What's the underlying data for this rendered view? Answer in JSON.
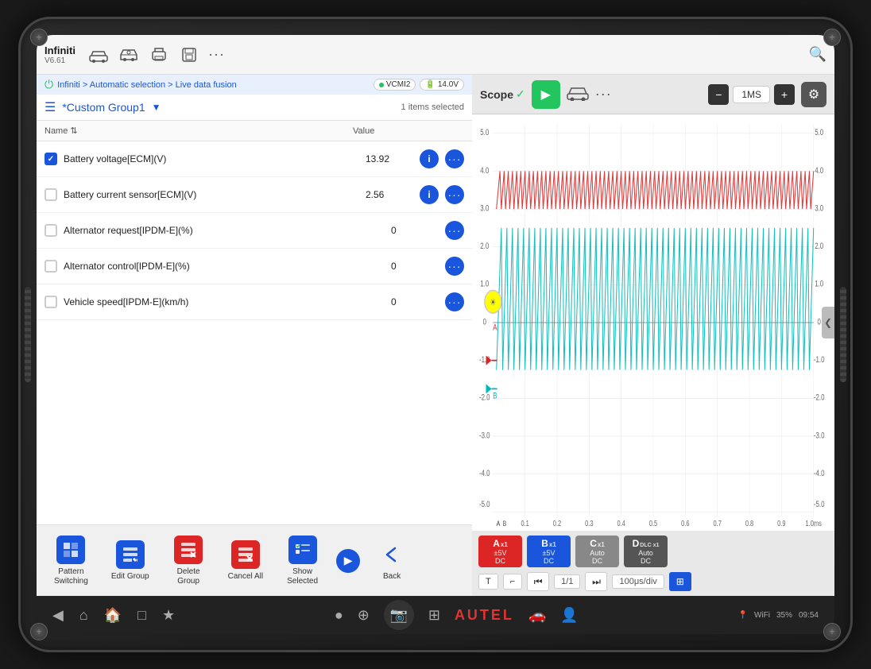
{
  "tablet": {
    "brand": "AUTEL"
  },
  "app_bar": {
    "brand_name": "Infiniti",
    "brand_version": "V6.61",
    "icons": [
      "car-icon",
      "car2-icon",
      "print-icon",
      "save-icon"
    ],
    "dots_label": "···",
    "search_label": "🔍"
  },
  "breadcrumb": {
    "path": "Infiniti > Automatic selection > Live data fusion",
    "vcmi_label": "VCMI2",
    "voltage_label": "14.0V"
  },
  "group": {
    "name": "*Custom Group1",
    "selected_count": "1 items selected"
  },
  "table": {
    "col_name": "Name",
    "col_sort": "⇅",
    "col_value": "Value",
    "rows": [
      {
        "id": "row-1",
        "checked": true,
        "name": "Battery voltage[ECM](V)",
        "value": "13.92",
        "has_info": true,
        "has_more": true
      },
      {
        "id": "row-2",
        "checked": false,
        "name": "Battery current sensor[ECM](V)",
        "value": "2.56",
        "has_info": true,
        "has_more": true
      },
      {
        "id": "row-3",
        "checked": false,
        "name": "Alternator request[IPDM-E](%)",
        "value": "0",
        "has_info": false,
        "has_more": true
      },
      {
        "id": "row-4",
        "checked": false,
        "name": "Alternator control[IPDM-E](%)",
        "value": "0",
        "has_info": false,
        "has_more": true
      },
      {
        "id": "row-5",
        "checked": false,
        "name": "Vehicle speed[IPDM-E](km/h)",
        "value": "0",
        "has_info": false,
        "has_more": true
      }
    ]
  },
  "toolbar": {
    "buttons": [
      {
        "id": "pattern-switching",
        "label": "Pattern\nSwitching",
        "icon": "pattern-icon"
      },
      {
        "id": "edit-group",
        "label": "Edit Group",
        "icon": "edit-icon"
      },
      {
        "id": "delete-group",
        "label": "Delete\nGroup",
        "icon": "delete-icon"
      },
      {
        "id": "cancel-all",
        "label": "Cancel All",
        "icon": "cancel-icon"
      },
      {
        "id": "show-selected",
        "label": "Show\nSelected",
        "icon": "show-icon"
      }
    ],
    "back_label": "Back"
  },
  "scope": {
    "logo": "Scope",
    "time_value": "1MS",
    "channels": [
      {
        "id": "A",
        "label": "A",
        "sub": "x1",
        "range": "±5V",
        "mode": "DC",
        "color": "ch-a"
      },
      {
        "id": "B",
        "label": "B",
        "sub": "x1",
        "range": "±5V",
        "mode": "DC",
        "color": "ch-b"
      },
      {
        "id": "C",
        "label": "C",
        "sub": "x1",
        "range": "Auto",
        "mode": "DC",
        "color": "ch-c"
      },
      {
        "id": "D",
        "label": "D",
        "sub": "DLC x1",
        "range": "Auto",
        "mode": "DC",
        "color": "ch-d"
      }
    ],
    "transport": {
      "page": "1/1",
      "time_div": "100μs/div"
    },
    "y_axis": [
      "5.0",
      "4.0",
      "3.0",
      "2.0",
      "1.0",
      "0",
      "-1.0",
      "-2.0",
      "-3.0",
      "-4.0",
      "-5.0"
    ],
    "y_axis2": [
      "5.0",
      "4.0",
      "3.0",
      "2.0",
      "1.0",
      "0",
      "-1.0",
      "-2.0",
      "-3.0",
      "-4.0",
      "-5.0"
    ],
    "x_axis": [
      "0.1",
      "0.2",
      "0.3",
      "0.4",
      "0.5",
      "0.6",
      "0.7",
      "0.8",
      "0.9",
      "1.0ms"
    ]
  },
  "nav_bar": {
    "time": "09:54",
    "battery": "35%",
    "wifi": "WiFi",
    "vcmi2": "VCMI2"
  }
}
